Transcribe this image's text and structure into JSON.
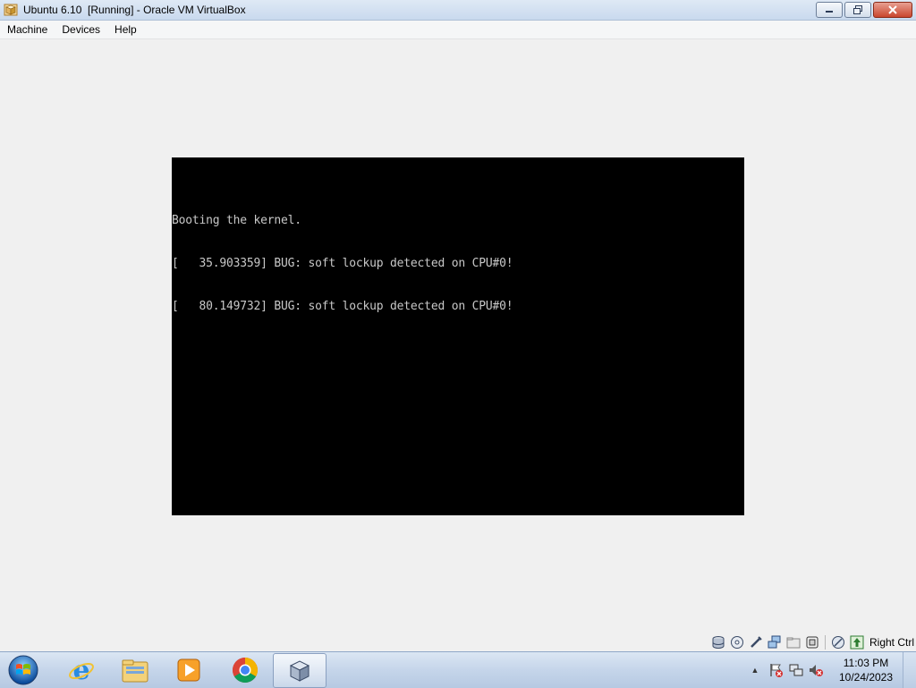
{
  "window": {
    "title": "Ubuntu 6.10  [Running] - Oracle VM VirtualBox",
    "icon": "virtualbox-app-icon",
    "controls": [
      "minimize",
      "restore",
      "close"
    ]
  },
  "menu": {
    "items": [
      {
        "label": "Machine"
      },
      {
        "label": "Devices"
      },
      {
        "label": "Help"
      }
    ]
  },
  "console": {
    "lines": [
      "Booting the kernel.",
      "[   35.903359] BUG: soft lockup detected on CPU#0!",
      "[   80.149732] BUG: soft lockup detected on CPU#0!"
    ],
    "text_color": "#c8c8c8",
    "background": "#000000"
  },
  "statusbar": {
    "icons": [
      "hard-disk-icon",
      "optical-drive-icon",
      "usb-icon",
      "network-icon",
      "shared-folders-icon",
      "video-capture-icon",
      "mouse-integration-icon",
      "host-key-arrow-icon"
    ],
    "host_key_label": "Right Ctrl"
  },
  "taskbar": {
    "start_icon": "windows-start-orb",
    "pinned": [
      {
        "name": "internet-explorer-icon"
      },
      {
        "name": "file-explorer-icon"
      },
      {
        "name": "media-player-icon"
      },
      {
        "name": "chrome-icon"
      },
      {
        "name": "virtualbox-icon",
        "active": true
      }
    ],
    "tray_icons": [
      "action-center-flag-icon",
      "network-tray-icon",
      "volume-muted-icon"
    ],
    "clock_time": "11:03 PM",
    "clock_date": "10/24/2023"
  }
}
